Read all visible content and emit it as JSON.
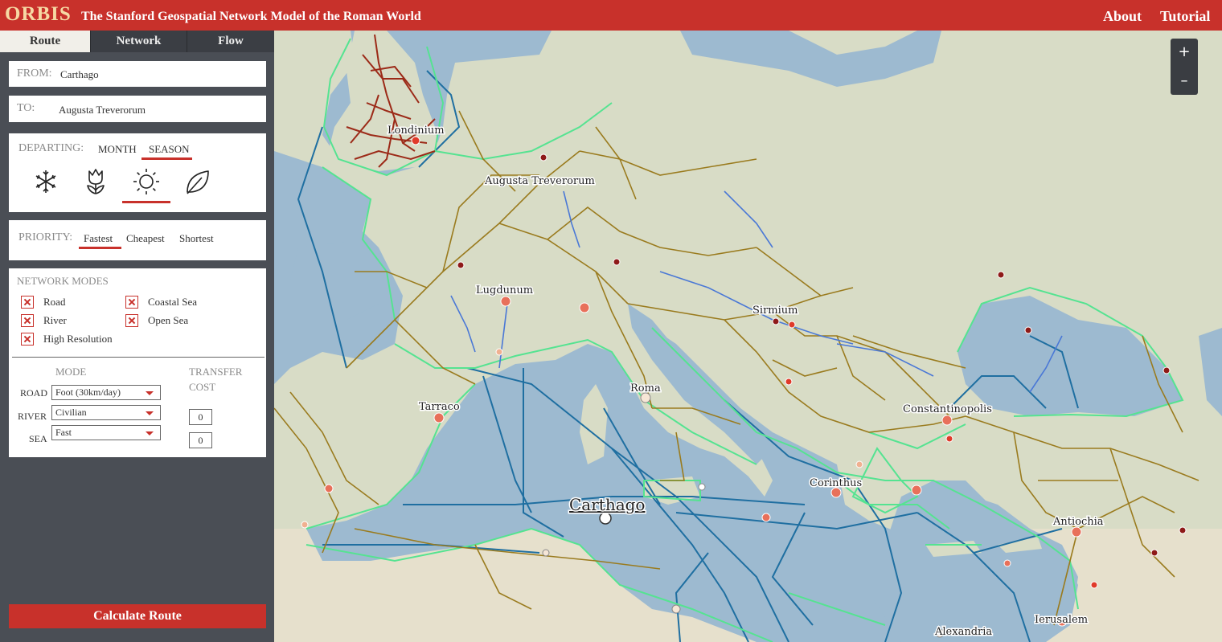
{
  "header": {
    "logo": "ORBIS",
    "subtitle": "The Stanford Geospatial Network Model of the Roman World",
    "nav_about": "About",
    "nav_tutorial": "Tutorial"
  },
  "tabs": [
    {
      "label": "Route",
      "active": true
    },
    {
      "label": "Network",
      "active": false
    },
    {
      "label": "Flow",
      "active": false
    }
  ],
  "route": {
    "from_label": "FROM:",
    "from_value": "Carthago",
    "to_label": "TO:",
    "to_value": "Augusta Treverorum"
  },
  "departing": {
    "label": "DEPARTING:",
    "options": [
      "MONTH",
      "SEASON"
    ],
    "selected": "SEASON",
    "seasons": [
      {
        "name": "winter",
        "icon": "snowflake-icon"
      },
      {
        "name": "spring",
        "icon": "tulip-icon"
      },
      {
        "name": "summer",
        "icon": "sun-icon",
        "selected": true
      },
      {
        "name": "autumn",
        "icon": "leaf-icon"
      }
    ]
  },
  "priority": {
    "label": "PRIORITY:",
    "options": [
      "Fastest",
      "Cheapest",
      "Shortest"
    ],
    "selected": "Fastest"
  },
  "network_modes": {
    "label": "NETWORK MODES",
    "items": [
      {
        "label": "Road",
        "checked": true
      },
      {
        "label": "Coastal Sea",
        "checked": true
      },
      {
        "label": "River",
        "checked": true
      },
      {
        "label": "Open Sea",
        "checked": true
      },
      {
        "label": "High Resolution",
        "checked": true
      }
    ]
  },
  "modes": {
    "mode_header": "MODE",
    "transfer_header_1": "TRANSFER",
    "transfer_header_2": "COST",
    "road_label": "ROAD",
    "road_value": "Foot (30km/day)",
    "river_label": "RIVER",
    "river_value": "Civilian",
    "river_cost": "0",
    "sea_label": "SEA",
    "sea_value": "Fast",
    "sea_cost": "0"
  },
  "calculate_button": "Calculate Route",
  "map": {
    "zoom_in": "+",
    "zoom_out": "–",
    "cities": {
      "londinium": "Londinium",
      "augusta_treverorum": "Augusta Treverorum",
      "lugdunum": "Lugdunum",
      "sirmium": "Sirmium",
      "roma": "Roma",
      "tarraco": "Tarraco",
      "constantinopolis": "Constantinopolis",
      "corinthus": "Corinthus",
      "carthago": "Carthago",
      "antiochia": "Antiochia",
      "ierusalem": "Ierusalem",
      "alexandria": "Alexandria"
    },
    "colors": {
      "sea": "#9dbad0",
      "land": "#d8dcc6",
      "road": "#9a7b1e",
      "river": "#4a78d6",
      "coastal_sea": "#55e391",
      "open_sea": "#1f6fa1",
      "city_node": "#e8705a"
    }
  }
}
